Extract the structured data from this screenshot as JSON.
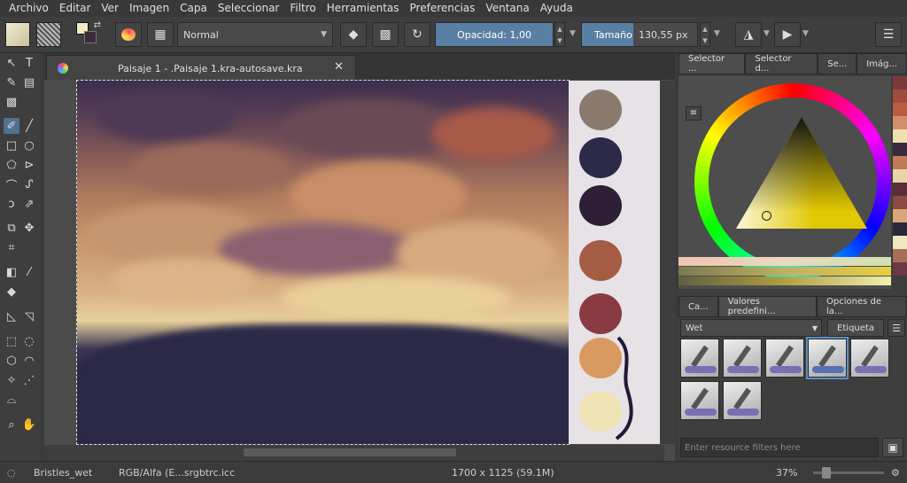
{
  "menu": [
    "Archivo",
    "Editar",
    "Ver",
    "Imagen",
    "Capa",
    "Seleccionar",
    "Filtro",
    "Herramientas",
    "Preferencias",
    "Ventana",
    "Ayuda"
  ],
  "toolbar": {
    "blend_mode": "Normal",
    "opacity_label": "Opacidad:",
    "opacity_value": "1,00",
    "size_label": "Tamaño:",
    "size_value": "130,55 px"
  },
  "document": {
    "tab_title": "Paisaje 1 - .Paisaje 1.kra-autosave.kra"
  },
  "palette_swatches": [
    "#8a7a6e",
    "#2c2a48",
    "#2e1f36",
    "#a45c44",
    "#8a3a42",
    "#d99a62",
    "#efe4b5"
  ],
  "right_panel": {
    "color_tabs": [
      "Selector ...",
      "Selector d...",
      "Se...",
      "Imág..."
    ],
    "history_colors": [
      "#7a3a3a",
      "#a04c3c",
      "#b95c3f",
      "#d09070",
      "#efe0b0",
      "#3a2a3c",
      "#c07a58",
      "#e8d6a8",
      "#5a2c38",
      "#8c4a44",
      "#d8a878",
      "#2a2838",
      "#f0e6c0",
      "#a67058",
      "#6a3846"
    ],
    "preset_tabs": [
      "Ca...",
      "Valores predefini...",
      "Opciones de la..."
    ],
    "tag_value": "Wet",
    "tag_button": "Etiqueta",
    "filter_placeholder": "Enter resource filters here"
  },
  "status": {
    "brush": "Bristles_wet",
    "color_space": "RGB/Alfa (E...srgbtrc.icc",
    "dimensions": "1700 x 1125 (59.1M)",
    "zoom": "37%"
  },
  "colors": {
    "accent": "#5a7fa5",
    "background": "#3b3b3b"
  }
}
